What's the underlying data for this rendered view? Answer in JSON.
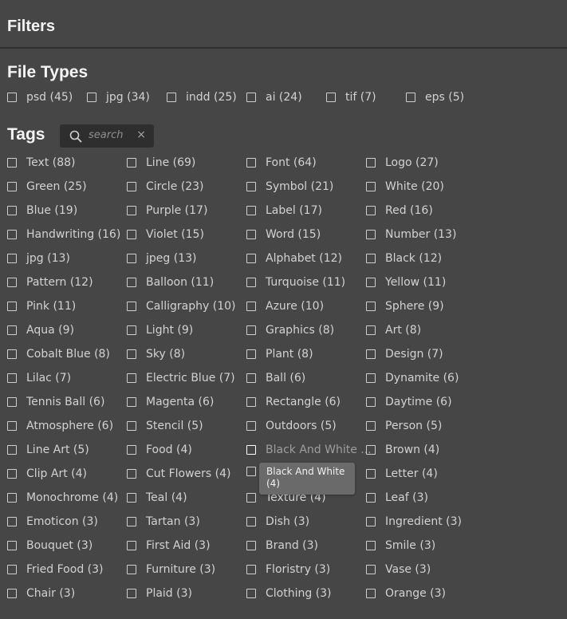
{
  "header": {
    "title": "Filters"
  },
  "file_types": {
    "title": "File Types",
    "items": [
      "psd (45)",
      "jpg (34)",
      "indd (25)",
      "ai (24)",
      "tif (7)",
      "eps (5)"
    ]
  },
  "tags": {
    "title": "Tags",
    "search_placeholder": "search",
    "clear_symbol": "×",
    "items": [
      [
        "Text (88)",
        "Line (69)",
        "Font (64)",
        "Logo (27)"
      ],
      [
        "Green (25)",
        "Circle (23)",
        "Symbol (21)",
        "White (20)"
      ],
      [
        "Blue (19)",
        "Purple (17)",
        "Label (17)",
        "Red (16)"
      ],
      [
        "Handwriting (16)",
        "Violet (15)",
        "Word (15)",
        "Number (13)"
      ],
      [
        "jpg (13)",
        "jpeg (13)",
        "Alphabet (12)",
        "Black (12)"
      ],
      [
        "Pattern (12)",
        "Balloon (11)",
        "Turquoise (11)",
        "Yellow (11)"
      ],
      [
        "Pink (11)",
        "Calligraphy (10)",
        "Azure (10)",
        "Sphere (9)"
      ],
      [
        "Aqua (9)",
        "Light (9)",
        "Graphics (8)",
        "Art (8)"
      ],
      [
        "Cobalt Blue (8)",
        "Sky (8)",
        "Plant (8)",
        "Design (7)"
      ],
      [
        "Lilac (7)",
        "Electric Blue (7)",
        "Ball (6)",
        "Dynamite (6)"
      ],
      [
        "Tennis Ball (6)",
        "Magenta (6)",
        "Rectangle (6)",
        "Daytime (6)"
      ],
      [
        "Atmosphere (6)",
        "Stencil (5)",
        "Outdoors (5)",
        "Person (5)"
      ],
      [
        "Line Art (5)",
        "Food (4)",
        "Black And White ...",
        "Brown (4)"
      ],
      [
        "Clip Art (4)",
        "Cut Flowers (4)",
        "",
        "Letter (4)"
      ],
      [
        "Monochrome (4)",
        "Teal (4)",
        "Texture (4)",
        "Leaf (3)"
      ],
      [
        "Emoticon (3)",
        "Tartan (3)",
        "Dish (3)",
        "Ingredient (3)"
      ],
      [
        "Bouquet (3)",
        "First Aid (3)",
        "Brand (3)",
        "Smile (3)"
      ],
      [
        "Fried Food (3)",
        "Furniture (3)",
        "Floristry (3)",
        "Vase (3)"
      ],
      [
        "Chair (3)",
        "Plaid (3)",
        "Clothing (3)",
        "Orange (3)"
      ]
    ],
    "tooltip": {
      "line1": "Black And White",
      "line2": "(4)"
    }
  }
}
